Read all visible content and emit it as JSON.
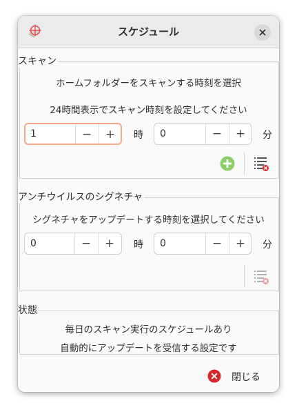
{
  "window": {
    "title": "スケジュール"
  },
  "scan": {
    "legend": "スキャン",
    "line1": "ホームフォルダーをスキャンする時刻を選択",
    "line2": "24時間表示でスキャン時刻を設定してください",
    "hour_value": "1",
    "minute_value": "0",
    "hour_unit": "時",
    "minute_unit": "分"
  },
  "signatures": {
    "legend": "アンチウイルスのシグネチャ",
    "line1": "シグネチャをアップデートする時刻を選択してください",
    "hour_value": "0",
    "minute_value": "0",
    "hour_unit": "時",
    "minute_unit": "分"
  },
  "status": {
    "legend": "状態",
    "line1": "毎日のスキャン実行のスケジュールあり",
    "line2": "自動的にアップデートを受信する設定です"
  },
  "spin": {
    "minus": "−",
    "plus": "+"
  },
  "footer": {
    "close_label": "閉じる"
  },
  "colors": {
    "accent_focus": "#f0a887",
    "add_green": "#8ccf6a",
    "close_red": "#d8262c"
  },
  "icons": {
    "app": "clamav-crosshair-icon",
    "close": "close-icon",
    "add": "add-circle-icon",
    "remove_list": "list-remove-icon",
    "footer_close": "close-circle-icon"
  }
}
